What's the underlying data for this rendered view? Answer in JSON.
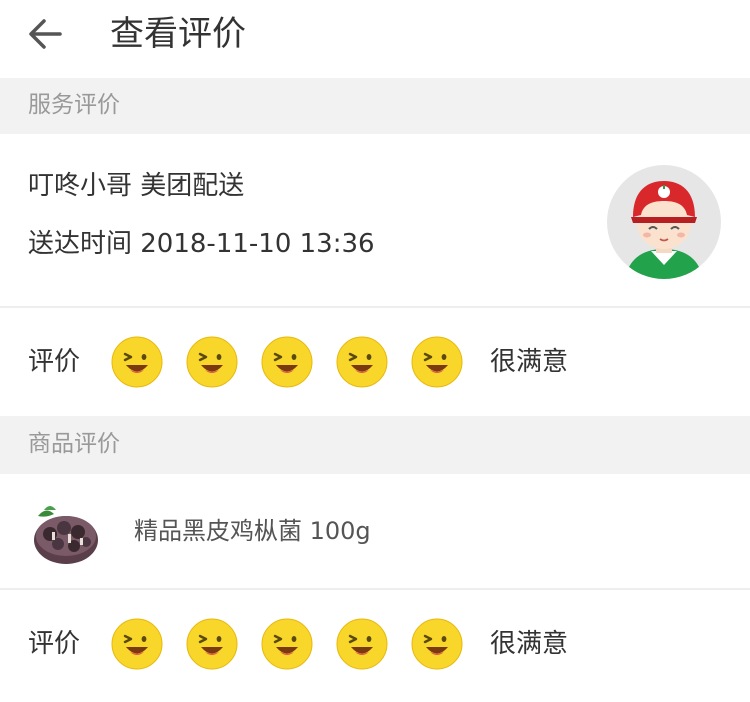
{
  "header": {
    "back_icon": "arrow-left-icon",
    "title": "查看评价"
  },
  "service_section": {
    "title": "服务评价",
    "courier_name": "叮咚小哥 美团配送",
    "delivery_time": "送达时间 2018-11-10 13:36",
    "avatar_icon": "courier-avatar-icon",
    "rating": {
      "label": "评价",
      "stars_total": 5,
      "stars_selected": 5,
      "star_icon": "smiley-face-icon",
      "text": "很满意"
    }
  },
  "product_section": {
    "title": "商品评价",
    "product_name": "精品黑皮鸡枞菌 100g",
    "thumb_icon": "mushroom-thumbnail-icon",
    "rating": {
      "label": "评价",
      "stars_total": 5,
      "stars_selected": 5,
      "star_icon": "smiley-face-icon",
      "text": "很满意"
    }
  },
  "colors": {
    "section_bg": "#f2f2f2",
    "section_text": "#999999",
    "primary_text": "#333333",
    "star_yellow": "#f8d62a",
    "helmet_red": "#d8282c",
    "uniform_green": "#22a24a"
  }
}
